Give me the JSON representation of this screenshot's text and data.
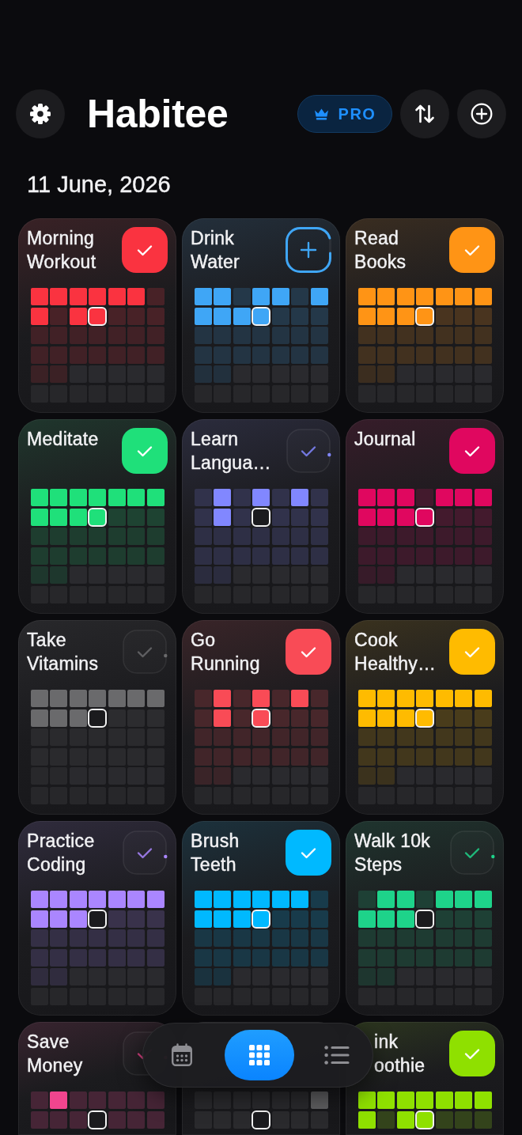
{
  "header": {
    "title": "Habitee",
    "pro_label": "PRO"
  },
  "date": "11 June, 2026",
  "calendar": {
    "days": [
      {
        "today": false
      },
      {
        "today": false
      },
      {
        "today": false
      },
      {
        "today": false
      },
      {
        "today": false
      },
      {
        "today": false
      },
      {
        "today": false
      },
      {
        "today": false
      },
      {
        "today": false
      },
      {
        "today": false
      },
      {
        "today": true
      },
      {
        "today": false
      },
      {
        "today": false
      },
      {
        "today": false
      },
      {
        "today": false
      },
      {
        "today": false
      },
      {
        "today": false
      },
      {
        "today": false
      },
      {
        "today": false
      },
      {
        "today": false
      },
      {
        "today": false
      },
      {
        "today": false
      },
      {
        "today": false
      },
      {
        "today": false
      },
      {
        "today": false
      },
      {
        "today": false
      },
      {
        "today": false
      },
      {
        "today": false
      },
      {
        "today": false
      },
      {
        "today": false
      }
    ]
  },
  "habits": [
    {
      "title": "Morning Workout",
      "color": "#fa3340",
      "button": {
        "kind": "check",
        "checked": true
      },
      "done": [
        true,
        true,
        true,
        true,
        true,
        true,
        false,
        true,
        false,
        true,
        true,
        false,
        false,
        false,
        false,
        false,
        false,
        false,
        false,
        false,
        false,
        false,
        false,
        false,
        false,
        false,
        false,
        false,
        false,
        false
      ]
    },
    {
      "title": "Drink Water",
      "color": "#3fa6f6",
      "button": {
        "kind": "counter",
        "level": 0.9
      },
      "done": [
        true,
        true,
        false,
        true,
        true,
        false,
        true,
        true,
        true,
        true,
        true,
        false,
        false,
        false,
        false,
        false,
        false,
        false,
        false,
        false,
        false,
        false,
        false,
        false,
        false,
        false,
        false,
        false,
        false,
        false
      ]
    },
    {
      "title": "Read Books",
      "color": "#ff9415",
      "button": {
        "kind": "check",
        "checked": true
      },
      "done": [
        true,
        true,
        true,
        true,
        true,
        true,
        true,
        true,
        true,
        true,
        true,
        false,
        false,
        false,
        false,
        false,
        false,
        false,
        false,
        false,
        false,
        false,
        false,
        false,
        false,
        false,
        false,
        false,
        false,
        false
      ]
    },
    {
      "title": "Meditate",
      "color": "#1fe07a",
      "button": {
        "kind": "check",
        "checked": true
      },
      "done": [
        true,
        true,
        true,
        true,
        true,
        true,
        true,
        true,
        true,
        true,
        true,
        false,
        false,
        false,
        false,
        false,
        false,
        false,
        false,
        false,
        false,
        false,
        false,
        false,
        false,
        false,
        false,
        false,
        false,
        false
      ]
    },
    {
      "title": "Learn Langua…",
      "color": "#8187ff",
      "button": {
        "kind": "check",
        "checked": false
      },
      "done": [
        false,
        true,
        false,
        true,
        false,
        true,
        false,
        false,
        true,
        false,
        false,
        false,
        false,
        false,
        false,
        false,
        false,
        false,
        false,
        false,
        false,
        false,
        false,
        false,
        false,
        false,
        false,
        false,
        false,
        false
      ]
    },
    {
      "title": "Journal",
      "color": "#e0075f",
      "button": {
        "kind": "check",
        "checked": true
      },
      "done": [
        true,
        true,
        true,
        false,
        true,
        true,
        true,
        true,
        true,
        true,
        true,
        false,
        false,
        false,
        false,
        false,
        false,
        false,
        false,
        false,
        false,
        false,
        false,
        false,
        false,
        false,
        false,
        false,
        false,
        false
      ]
    },
    {
      "title": "Take Vitamins",
      "color": "#6a6a6c",
      "button": {
        "kind": "check",
        "checked": false
      },
      "done": [
        true,
        true,
        true,
        true,
        true,
        true,
        true,
        true,
        true,
        true,
        false,
        false,
        false,
        false,
        false,
        false,
        false,
        false,
        false,
        false,
        false,
        false,
        false,
        false,
        false,
        false,
        false,
        false,
        false,
        false
      ]
    },
    {
      "title": "Go Running",
      "color": "#f94b56",
      "button": {
        "kind": "check",
        "checked": true
      },
      "done": [
        false,
        true,
        false,
        true,
        false,
        true,
        false,
        false,
        true,
        false,
        true,
        false,
        false,
        false,
        false,
        false,
        false,
        false,
        false,
        false,
        false,
        false,
        false,
        false,
        false,
        false,
        false,
        false,
        false,
        false
      ]
    },
    {
      "title": "Cook Healthy…",
      "color": "#ffbb00",
      "button": {
        "kind": "check",
        "checked": true
      },
      "done": [
        true,
        true,
        true,
        true,
        true,
        true,
        true,
        true,
        true,
        true,
        true,
        false,
        false,
        false,
        false,
        false,
        false,
        false,
        false,
        false,
        false,
        false,
        false,
        false,
        false,
        false,
        false,
        false,
        false,
        false
      ]
    },
    {
      "title": "Practice Coding",
      "color": "#aa86ff",
      "button": {
        "kind": "check",
        "checked": false
      },
      "done": [
        true,
        true,
        true,
        true,
        true,
        true,
        true,
        true,
        true,
        true,
        false,
        false,
        false,
        false,
        false,
        false,
        false,
        false,
        false,
        false,
        false,
        false,
        false,
        false,
        false,
        false,
        false,
        false,
        false,
        false
      ]
    },
    {
      "title": "Brush Teeth",
      "color": "#00b9ff",
      "button": {
        "kind": "check",
        "checked": true
      },
      "done": [
        true,
        true,
        true,
        true,
        true,
        true,
        false,
        true,
        true,
        true,
        true,
        false,
        false,
        false,
        false,
        false,
        false,
        false,
        false,
        false,
        false,
        false,
        false,
        false,
        false,
        false,
        false,
        false,
        false,
        false
      ]
    },
    {
      "title": "Walk 10k Steps",
      "color": "#1ed38a",
      "button": {
        "kind": "check",
        "checked": false
      },
      "done": [
        false,
        true,
        true,
        false,
        true,
        true,
        true,
        true,
        true,
        true,
        false,
        false,
        false,
        false,
        false,
        false,
        false,
        false,
        false,
        false,
        false,
        false,
        false,
        false,
        false,
        false,
        false,
        false,
        false,
        false
      ]
    },
    {
      "title": "Save Money",
      "color": "#f0458e",
      "button": {
        "kind": "check",
        "checked": false
      },
      "done": [
        false,
        true,
        false,
        false,
        false,
        false,
        false,
        false,
        false,
        false,
        false,
        false,
        false,
        false
      ]
    },
    {
      "color": "#5e5e60",
      "done": [
        false,
        false,
        false,
        false,
        false,
        false,
        true,
        false,
        false,
        false,
        false,
        false,
        false,
        false
      ]
    },
    {
      "title": "ink oothie",
      "color": "#8fe000",
      "button": {
        "kind": "check",
        "checked": true
      },
      "done": [
        true,
        true,
        true,
        true,
        true,
        true,
        true,
        true,
        false,
        true,
        true,
        false,
        false,
        false
      ]
    }
  ],
  "nav": {
    "tabs": [
      {
        "selected": false
      },
      {
        "selected": true
      },
      {
        "selected": false
      }
    ]
  }
}
